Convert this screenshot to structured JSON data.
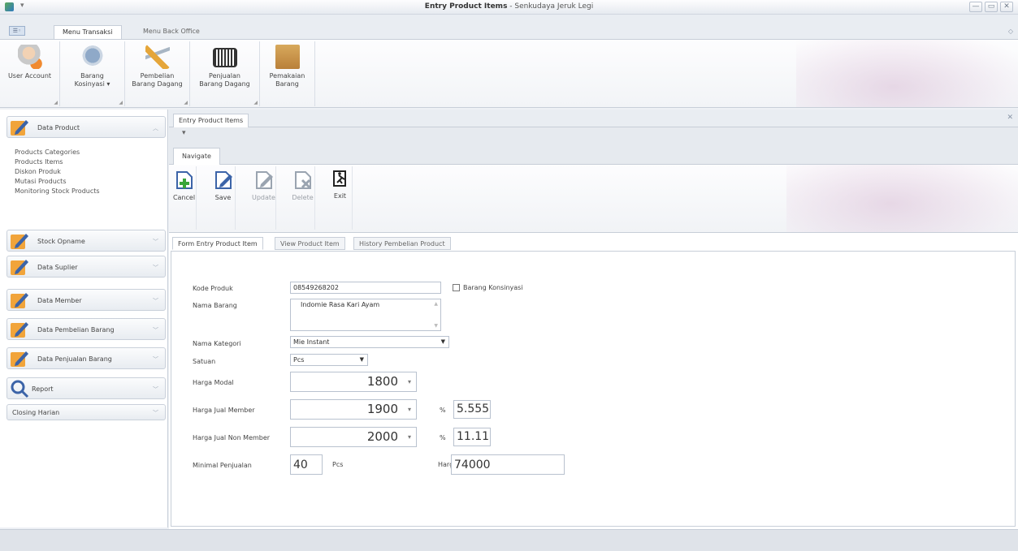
{
  "window": {
    "title_main": "Entry Product Items",
    "title_sub": " - Senkudaya Jeruk Legi",
    "min": "—",
    "max": "▭",
    "close": "✕"
  },
  "ribbon": {
    "tabs": [
      "Menu Transaksi",
      "Menu Back Office"
    ],
    "buttons": [
      {
        "label": "User Account"
      },
      {
        "label": "Barang Kosinyasi ▾"
      },
      {
        "label": "Pembelian Barang Dagang"
      },
      {
        "label": "Penjualan Barang Dagang"
      },
      {
        "label": "Pemakaian Barang"
      }
    ]
  },
  "leftnav": {
    "group1": "Data Product",
    "items": [
      "Products Categories",
      "Products Items",
      "Diskon Produk",
      "Mutasi Products",
      "Monitoring Stock Products"
    ],
    "groups": [
      "Stock Opname",
      "Data Suplier",
      "Data Member",
      "Data Pembelian Barang",
      "Data Penjualan Barang",
      "Report",
      "Closing Harian"
    ]
  },
  "doc": {
    "tab": "Entry Product Items",
    "subtab": "Navigate",
    "actions": [
      {
        "label": "Cancel",
        "enabled": true
      },
      {
        "label": "Save",
        "enabled": true
      },
      {
        "label": "Update",
        "enabled": false
      },
      {
        "label": "Delete",
        "enabled": false
      },
      {
        "label": "Exit",
        "enabled": true
      }
    ],
    "formtabs": [
      "Form Entry Product Item",
      "View Product Item",
      "History Pembelian Product"
    ]
  },
  "form": {
    "kode_label": "Kode Produk",
    "kode_value": "08549268202",
    "konsinyasi_label": "Barang Konsinyasi",
    "konsinyasi_checked": false,
    "nama_label": "Nama Barang",
    "nama_value": "Indomie Rasa Kari Ayam",
    "kategori_label": "Nama Kategori",
    "kategori_value": "Mie Instant",
    "satuan_label": "Satuan",
    "satuan_value": "Pcs",
    "modal_label": "Harga Modal",
    "modal_value": "1800",
    "member_label": "Harga Jual Member",
    "member_value": "1900",
    "member_pct": "5.555",
    "nonmember_label": "Harga Jual Non Member",
    "nonmember_value": "2000",
    "nonmember_pct": "11.11",
    "pct_sign": "%",
    "minimal_label": "Minimal Penjualan",
    "minimal_value": "40",
    "minimal_unit": "Pcs",
    "harga_label": "Harga",
    "harga_value": "74000"
  }
}
